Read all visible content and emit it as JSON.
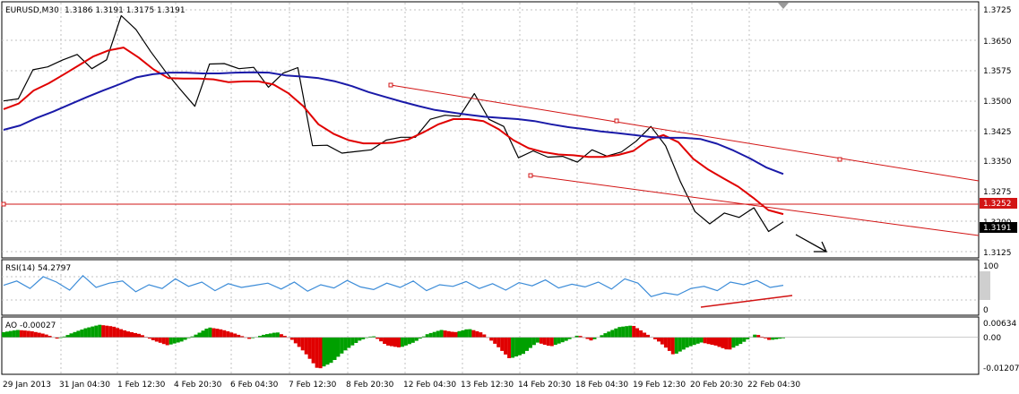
{
  "window": {
    "symbol_timeframe": "EURUSD,M30",
    "ohlc": "1.3186 1.3191 1.3175 1.3191"
  },
  "colors": {
    "background": "#ffffff",
    "grid": "#c0c0c0",
    "price": "#000000",
    "ma_fast": "#e00000",
    "ma_slow": "#1a1aa8",
    "channel": "#d21414",
    "rsi": "#3c8cd8",
    "ao_up": "#00a000",
    "ao_down": "#e00000",
    "current_price_bg": "#000000",
    "hline_label_bg": "#d21414"
  },
  "main_panel": {
    "price_levels": [
      "1.3725",
      "1.3650",
      "1.3575",
      "1.3500",
      "1.3425",
      "1.3350",
      "1.3275",
      "1.3125"
    ],
    "ylim": [
      1.3098,
      1.3738
    ],
    "hline_label": "1.3252",
    "current_price_label": "1.3191",
    "hidden_level_label": "1.3200",
    "arrow_icon": "trend-arrow-down-right-icon"
  },
  "rsi_panel": {
    "label": "RSI(14) 54.2797",
    "levels": [
      "100",
      "0"
    ],
    "ylim": [
      0,
      100
    ],
    "guide_levels": [
      70,
      30
    ]
  },
  "ao_panel": {
    "label": "AO -0.00027",
    "levels": [
      "0.00634",
      "0.00",
      "-0.01207"
    ],
    "ylim": [
      -0.0126,
      0.0068
    ]
  },
  "time_axis": {
    "labels": [
      "29 Jan 2013",
      "31 Jan 04:30",
      "1 Feb 12:30",
      "4 Feb 20:30",
      "6 Feb 04:30",
      "7 Feb 12:30",
      "8 Feb 20:30",
      "12 Feb 04:30",
      "13 Feb 12:30",
      "14 Feb 20:30",
      "18 Feb 04:30",
      "19 Feb 12:30",
      "20 Feb 20:30",
      "22 Feb 04:30"
    ]
  },
  "chart_data": [
    {
      "type": "line",
      "panel": "main",
      "ylim": [
        1.3098,
        1.3738
      ],
      "series": [
        {
          "name": "EURUSD,M30",
          "values": [
            1.3488,
            1.3496,
            1.3572,
            1.3575,
            1.3595,
            1.3605,
            1.3572,
            1.3597,
            1.3704,
            1.3672,
            1.3612,
            1.3565,
            1.3523,
            1.3476,
            1.3585,
            1.3582,
            1.3572,
            1.3578,
            1.3524,
            1.3562,
            1.3572,
            1.3378,
            1.3382,
            1.3358,
            1.3365,
            1.3365,
            1.3392,
            1.3402,
            1.3398,
            1.3446,
            1.3452,
            1.3452,
            1.3512,
            1.3443,
            1.3428,
            1.3345,
            1.3365,
            1.3352,
            1.335,
            1.3338,
            1.3365,
            1.3352,
            1.3365,
            1.3388,
            1.3428,
            1.3375,
            1.3288,
            1.3215,
            1.318,
            1.321,
            1.3195,
            1.3222,
            1.3165,
            1.3185
          ]
        },
        {
          "name": "",
          "values": [
            1.347,
            1.3484,
            1.3517,
            1.3535,
            1.3557,
            1.358,
            1.3603,
            1.3618,
            1.3625,
            1.36,
            1.357,
            1.3548,
            1.3547,
            1.3547,
            1.3545,
            1.3538,
            1.354,
            1.354,
            1.3532,
            1.351,
            1.3477,
            1.3432,
            1.3408,
            1.3392,
            1.3384,
            1.3384,
            1.3386,
            1.3394,
            1.3412,
            1.3432,
            1.3445,
            1.3445,
            1.344,
            1.342,
            1.3392,
            1.3372,
            1.3362,
            1.3356,
            1.3354,
            1.335,
            1.335,
            1.3355,
            1.3365,
            1.3392,
            1.3405,
            1.3387,
            1.3345,
            1.3318,
            1.3296,
            1.3275,
            1.3247,
            1.3216,
            1.3206
          ]
        },
        {
          "name": "",
          "values": [
            1.3418,
            1.3429,
            1.3448,
            1.3464,
            1.3482,
            1.35,
            1.3517,
            1.3533,
            1.355,
            1.3558,
            1.3562,
            1.3562,
            1.356,
            1.356,
            1.3562,
            1.3563,
            1.3562,
            1.3555,
            1.3552,
            1.3548,
            1.354,
            1.3528,
            1.3513,
            1.3501,
            1.3489,
            1.3478,
            1.3468,
            1.3462,
            1.3456,
            1.3451,
            1.3448,
            1.3445,
            1.344,
            1.3432,
            1.3425,
            1.342,
            1.3414,
            1.341,
            1.3405,
            1.34,
            1.3398,
            1.3398,
            1.3395,
            1.3383,
            1.3366,
            1.3346,
            1.3323,
            1.3307
          ]
        }
      ]
    },
    {
      "type": "line",
      "panel": "rsi",
      "ylim": [
        0,
        100
      ],
      "series": [
        {
          "name": "RSI(14)",
          "values": [
            54,
            62,
            48,
            70,
            60,
            45,
            72,
            50,
            58,
            62,
            42,
            55,
            48,
            66,
            52,
            60,
            44,
            57,
            50,
            54,
            58,
            47,
            60,
            43,
            55,
            49,
            63,
            51,
            46,
            58,
            50,
            62,
            44,
            55,
            52,
            61,
            48,
            57,
            45,
            59,
            53,
            64,
            49,
            56,
            51,
            60,
            47,
            66,
            58,
            33,
            40,
            36,
            48,
            52,
            44,
            60,
            55,
            63,
            50,
            54
          ]
        }
      ]
    },
    {
      "type": "bar",
      "panel": "ao",
      "ylim": [
        -0.0126,
        0.0068
      ],
      "series": [
        {
          "name": "AO",
          "values": [
            0.0018,
            0.0026,
            0.0022,
            0.0012,
            -0.0006,
            0.0015,
            0.0032,
            0.0044,
            0.0038,
            0.0022,
            0.0011,
            -0.0012,
            -0.0028,
            -0.0015,
            0.0008,
            0.0035,
            0.0027,
            0.0012,
            -0.0006,
            0.0009,
            0.0018,
            -0.0005,
            -0.0052,
            -0.0112,
            -0.0088,
            -0.0045,
            -0.0012,
            0.0006,
            -0.0028,
            -0.0036,
            -0.0018,
            0.0012,
            0.0026,
            0.0018,
            0.003,
            0.0016,
            -0.0026,
            -0.0075,
            -0.0058,
            -0.0018,
            -0.0032,
            -0.0015,
            0.0008,
            -0.0012,
            0.0015,
            0.0036,
            0.0042,
            0.0012,
            -0.0018,
            -0.0062,
            -0.0035,
            -0.0018,
            -0.0028,
            -0.0045,
            -0.002,
            0.0012,
            -0.001,
            -0.0003
          ]
        }
      ]
    }
  ]
}
